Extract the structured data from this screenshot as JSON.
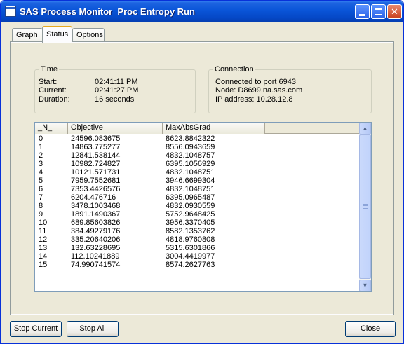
{
  "window": {
    "title": "SAS Process Monitor  Proc Entropy Run"
  },
  "tabs": [
    {
      "label": "Graph"
    },
    {
      "label": "Status"
    },
    {
      "label": "Options"
    }
  ],
  "time": {
    "label": "Time",
    "start_label": "Start:",
    "start_value": "02:41:11 PM",
    "current_label": "Current:",
    "current_value": "02:41:27 PM",
    "duration_label": "Duration:",
    "duration_value": "16 seconds"
  },
  "connection": {
    "label": "Connection",
    "lines": [
      "Connected to port 6943",
      "Node: D8699.na.sas.com",
      "IP address: 10.28.12.8"
    ]
  },
  "table": {
    "columns": [
      "_N_",
      "Objective",
      "MaxAbsGrad"
    ],
    "rows": [
      [
        "0",
        "24596.083675",
        "8623.8842322"
      ],
      [
        "1",
        "14863.775277",
        "8556.0943659"
      ],
      [
        "2",
        "12841.538144",
        "4832.1048757"
      ],
      [
        "3",
        "10982.724827",
        "6395.1056929"
      ],
      [
        "4",
        "10121.571731",
        "4832.1048751"
      ],
      [
        "5",
        "7959.7552681",
        "3946.6699304"
      ],
      [
        "6",
        "7353.4426576",
        "4832.1048751"
      ],
      [
        "7",
        "6204.476716",
        "6395.0965487"
      ],
      [
        "8",
        "3478.1003468",
        "4832.0930559"
      ],
      [
        "9",
        "1891.1490367",
        "5752.9648425"
      ],
      [
        "10",
        "689.85603826",
        "3956.3370405"
      ],
      [
        "11",
        "384.49279176",
        "8582.1353762"
      ],
      [
        "12",
        "335.20640206",
        "4818.9760808"
      ],
      [
        "13",
        "132.63228695",
        "5315.6301866"
      ],
      [
        "14",
        "112.10241889",
        "3004.4419977"
      ],
      [
        "15",
        "74.990741574",
        "8574.2627763"
      ]
    ]
  },
  "buttons": {
    "stop_current": "Stop Current",
    "stop_all": "Stop All",
    "close": "Close"
  }
}
